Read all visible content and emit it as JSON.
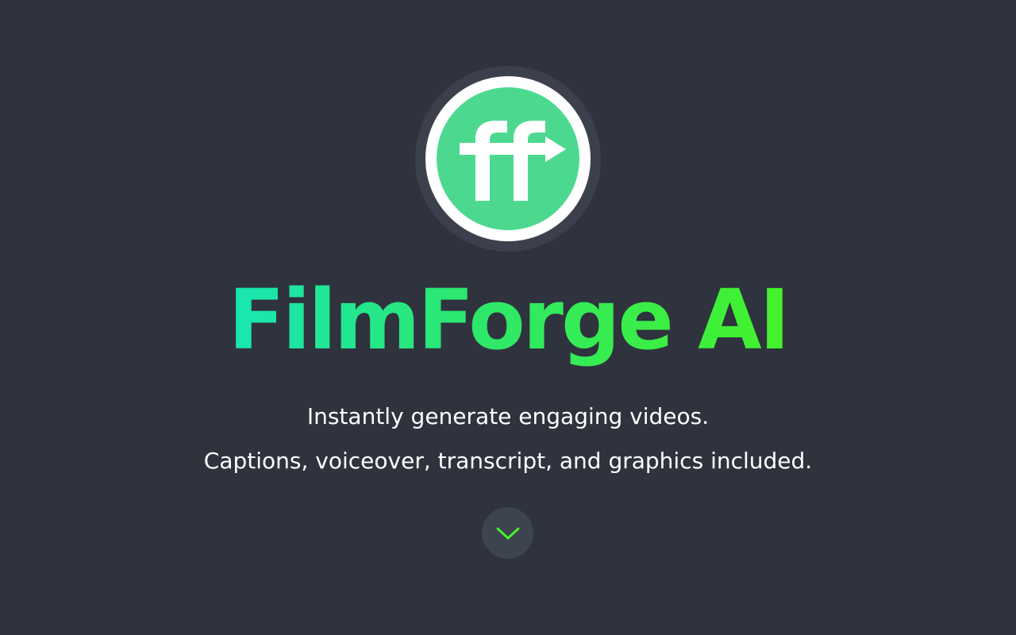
{
  "brand": {
    "logo_text": "ff",
    "name": "FilmForge AI",
    "accent_colors": [
      "#19e6b3",
      "#44f22a"
    ],
    "logo_color": "#4cd98f"
  },
  "hero": {
    "tagline_line1": "Instantly generate engaging videos.",
    "tagline_line2": "Captions, voiceover, transcript, and graphics included."
  },
  "scroll_button": {
    "icon": "chevron-down-icon",
    "icon_color": "#44f22a"
  }
}
